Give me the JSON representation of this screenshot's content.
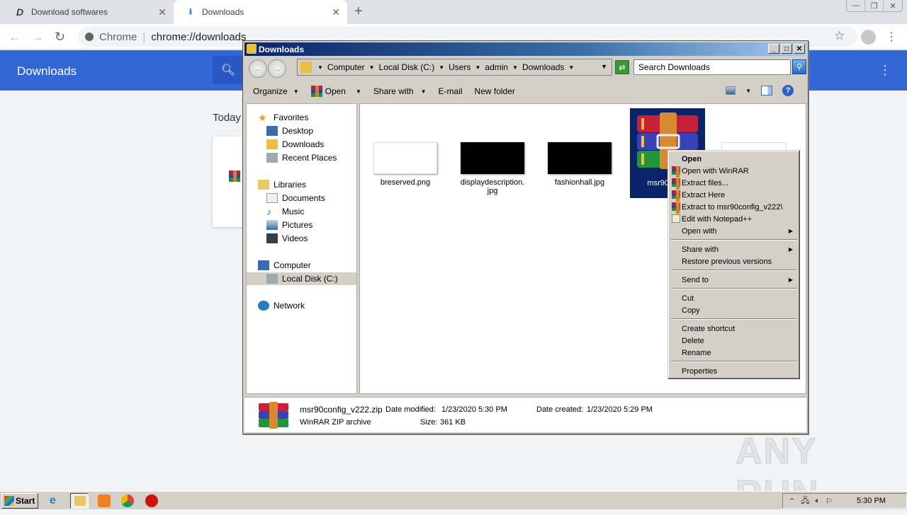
{
  "browser": {
    "tabs": [
      {
        "label": "Download softwares",
        "icon": "d-logo-icon"
      },
      {
        "label": "Downloads",
        "icon": "download-icon",
        "active": true
      }
    ],
    "omnibox": {
      "scheme_label": "Chrome",
      "url": "chrome://downloads"
    },
    "page": {
      "header_title": "Downloads",
      "section_label": "Today"
    }
  },
  "explorer": {
    "title": "Downloads",
    "breadcrumb": [
      "Computer",
      "Local Disk (C:)",
      "Users",
      "admin",
      "Downloads"
    ],
    "search_placeholder": "Search Downloads",
    "commands": [
      "Organize",
      "Open",
      "Share with",
      "E-mail",
      "New folder"
    ],
    "nav": {
      "favorites": {
        "label": "Favorites",
        "items": [
          "Desktop",
          "Downloads",
          "Recent Places"
        ]
      },
      "libraries": {
        "label": "Libraries",
        "items": [
          "Documents",
          "Music",
          "Pictures",
          "Videos"
        ]
      },
      "computer": {
        "label": "Computer",
        "items": [
          "Local Disk (C:)"
        ]
      },
      "network": {
        "label": "Network"
      }
    },
    "files": [
      {
        "name": "breserved.png",
        "thumb": "#ffffff"
      },
      {
        "name": "displaydescription.jpg",
        "thumb": "#000000"
      },
      {
        "name": "fashionhall.jpg",
        "thumb": "#000000"
      },
      {
        "name": "msr90config_v222.zip",
        "selected": true,
        "short_label": "msr90con zi"
      }
    ],
    "details": {
      "filename": "msr90config_v222.zip",
      "type": "WinRAR ZIP archive",
      "modified_label": "Date modified:",
      "modified": "1/23/2020 5:30 PM",
      "created_label": "Date created:",
      "created": "1/23/2020 5:29 PM",
      "size_label": "Size:",
      "size": "361 KB"
    }
  },
  "context_menu": {
    "groups": [
      [
        "Open",
        "Open with WinRAR",
        "Extract files...",
        "Extract Here",
        "Extract to msr90config_v222\\",
        "Edit with Notepad++",
        "Open with"
      ],
      [
        "Share with",
        "Restore previous versions"
      ],
      [
        "Send to"
      ],
      [
        "Cut",
        "Copy"
      ],
      [
        "Create shortcut",
        "Delete",
        "Rename"
      ],
      [
        "Properties"
      ]
    ]
  },
  "taskbar": {
    "start_label": "Start",
    "clock": "5:30 PM"
  },
  "watermark": "ANY RUN"
}
